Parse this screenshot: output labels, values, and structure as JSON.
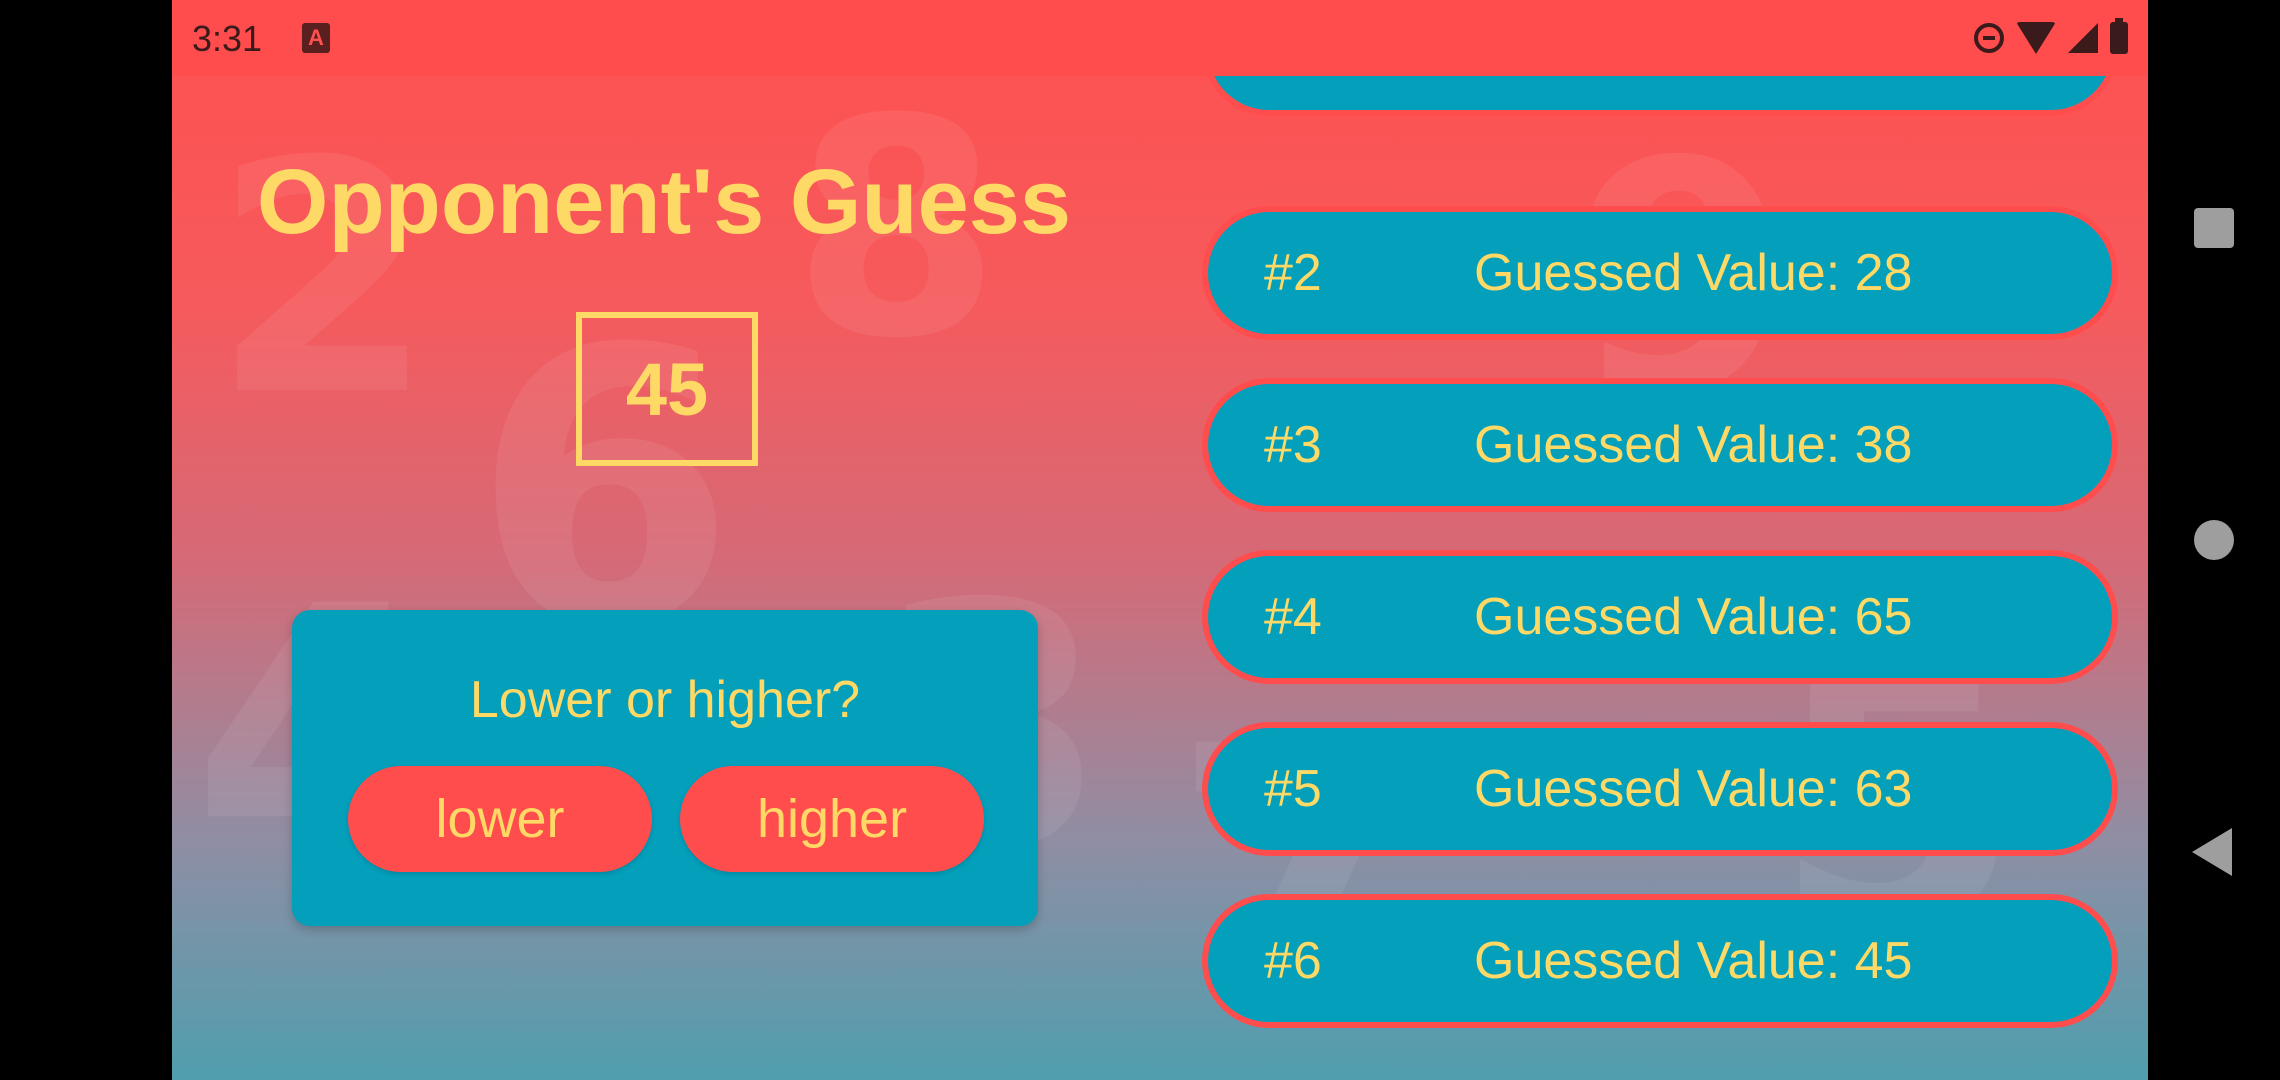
{
  "status_bar": {
    "time": "3:31",
    "app_icon_glyph": "A",
    "icons": [
      "dnd-icon",
      "wifi-icon",
      "signal-icon",
      "battery-icon"
    ]
  },
  "game": {
    "title": "Opponent's Guess",
    "current_guess": "45",
    "hint": {
      "question": "Lower or higher?",
      "lower_label": "lower",
      "higher_label": "higher"
    },
    "guess_log": [
      {
        "number": "#2",
        "label": "Guessed Value: 28"
      },
      {
        "number": "#3",
        "label": "Guessed Value: 38"
      },
      {
        "number": "#4",
        "label": "Guessed Value: 65"
      },
      {
        "number": "#5",
        "label": "Guessed Value: 63"
      },
      {
        "number": "#6",
        "label": "Guessed Value: 45"
      }
    ]
  },
  "colors": {
    "primary_red": "#ff4d4d",
    "accent_teal": "#049fbb",
    "text_yellow": "#ffd966"
  },
  "nav_bar": {
    "icons": [
      "recents-square-icon",
      "home-circle-icon",
      "back-triangle-icon"
    ]
  }
}
